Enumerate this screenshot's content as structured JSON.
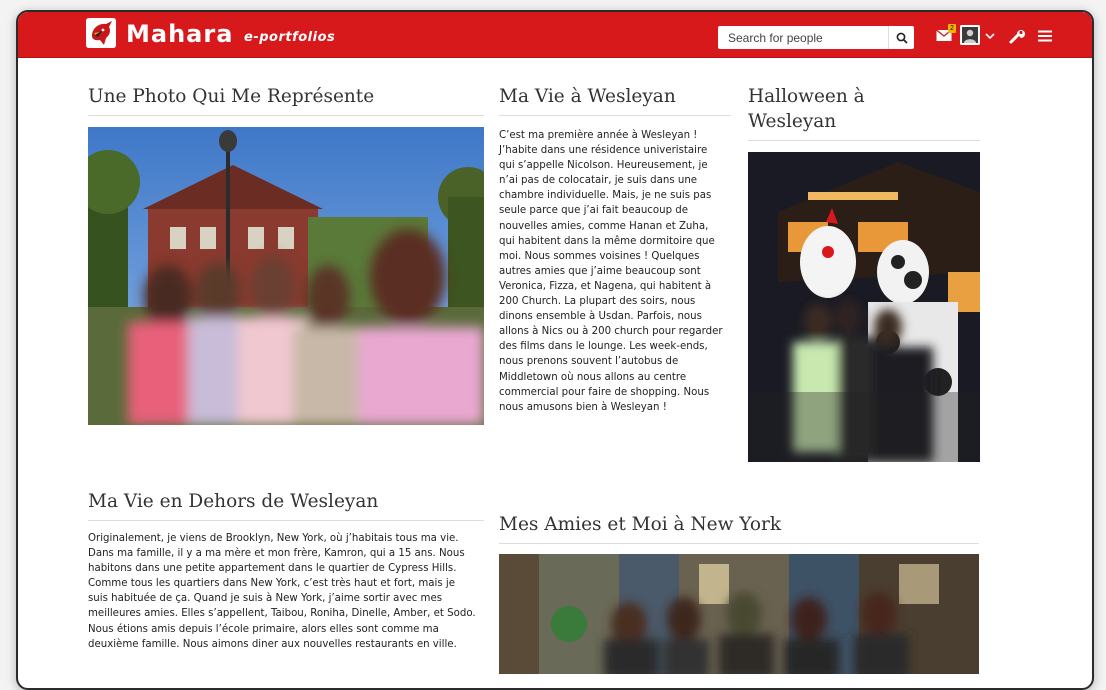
{
  "header": {
    "brand_name": "Mahara",
    "brand_tagline": "e-portfolios",
    "search_placeholder": "Search for people",
    "notification_count": "2",
    "icons": [
      "search-icon",
      "mail-icon",
      "avatar",
      "chevron-down-icon",
      "wrench-icon",
      "menu-icon"
    ],
    "bar_color": "#d8191c"
  },
  "blocks": {
    "photo_block": {
      "title": "Une Photo Qui Me Représente"
    },
    "wesleyan_life": {
      "title": "Ma Vie à Wesleyan",
      "lines": [
        "C’est ma première année à Wesleyan !",
        "J’habite dans une résidence univeristaire",
        "qui s’appelle Nicolson. Heureusement, je",
        "n’ai pas de colocatair, je suis dans une",
        "chambre individuelle. Mais, je ne suis pas",
        "seule parce que j’ai fait beaucoup de",
        "nouvelles amies, comme Hanan et Zuha,",
        "qui habitent dans la même dormitoire que",
        "moi. Nous sommes voisines ! Quelques",
        "autres amies que j’aime beaucoup sont",
        "Veronica, Fizza, et Nagena, qui habitent à",
        "200 Church. La plupart des soirs, nous",
        "dinons ensemble à Usdan. Parfois, nous",
        "allons à Nics ou à 200 church pour regarder",
        "des films dans le lounge. Les week-ends,",
        "nous prenons souvent l’autobus de",
        "Middletown où nous allons au centre",
        "commercial pour faire de shopping. Nous",
        "nous amusons bien à Wesleyan !"
      ]
    },
    "halloween": {
      "title_line1": "Halloween à",
      "title_line2": "Wesleyan"
    },
    "outside_life": {
      "title": "Ma Vie en Dehors de Wesleyan",
      "lines": [
        "Originalement, je viens de Brooklyn, New York, où j’habitais tous ma vie.",
        "Dans ma famille, il y a ma mère et mon frère, Kamron, qui a 15 ans. Nous",
        "habitons dans une petite appartement dans le quartier de Cypress Hills.",
        "Comme tous les quartiers dans New York, c’est très haut et fort, mais je",
        "suis habituée de ça. Quand je suis à New York, j’aime sortir avec mes",
        "meilleures amies. Elles s’appellent, Taibou, Roniha, Dinelle, Amber, et Sodo.",
        "Nous étions amis depuis l’école primaire, alors elles sont comme ma",
        "deuxième famille. Nous aimons diner aux nouvelles restaurants en ville."
      ]
    },
    "ny_friends": {
      "title": "Mes Amies et Moi à New York"
    }
  }
}
